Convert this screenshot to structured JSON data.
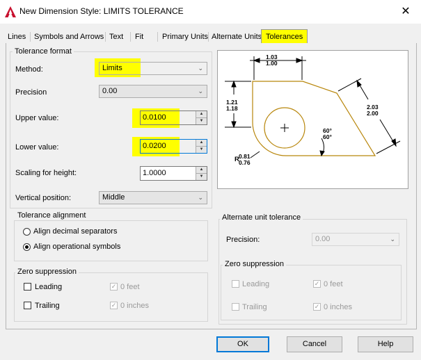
{
  "window": {
    "title": "New Dimension Style: LIMITS TOLERANCE",
    "close": "✕"
  },
  "tabs": [
    "Lines",
    "Symbols and Arrows",
    "Text",
    "Fit",
    "Primary Units",
    "Alternate Units",
    "Tolerances"
  ],
  "active_tab": "Tolerances",
  "tolerance_format": {
    "legend": "Tolerance format",
    "method_label": "Method:",
    "method_value": "Limits",
    "precision_label": "Precision",
    "precision_value": "0.00",
    "upper_label": "Upper value:",
    "upper_value": "0.0100",
    "lower_label": "Lower value:",
    "lower_value": "0.0200",
    "scaling_label": "Scaling for height:",
    "scaling_value": "1.0000",
    "vertical_label": "Vertical position:",
    "vertical_value": "Middle"
  },
  "tolerance_alignment": {
    "legend": "Tolerance alignment",
    "opt_decimal": "Align decimal separators",
    "opt_operational": "Align operational symbols",
    "selected": "Align operational symbols"
  },
  "zero_suppression_left": {
    "legend": "Zero suppression",
    "leading": "Leading",
    "trailing": "Trailing",
    "zero_feet": "0 feet",
    "zero_inches": "0 inches"
  },
  "alternate_unit_tolerance": {
    "legend": "Alternate unit tolerance",
    "precision_label": "Precision:",
    "precision_value": "0.00"
  },
  "zero_suppression_right": {
    "legend": "Zero suppression",
    "leading": "Leading",
    "trailing": "Trailing",
    "zero_feet": "0 feet",
    "zero_inches": "0 inches"
  },
  "preview": {
    "top_upper": "1.03",
    "top_lower": "1.00",
    "left_upper": "1.21",
    "left_lower": "1.18",
    "right_upper": "2.03",
    "right_lower": "2.00",
    "angle_upper": "60°",
    "angle_lower": "60°",
    "radius_prefix": "R",
    "radius_upper": "0.81",
    "radius_lower": "0.76"
  },
  "buttons": {
    "ok": "OK",
    "cancel": "Cancel",
    "help": "Help"
  },
  "colors": {
    "highlight": "#ffff00",
    "accent": "#0078d7",
    "app_icon": "#c8102e",
    "drawing": "#b8860b"
  }
}
